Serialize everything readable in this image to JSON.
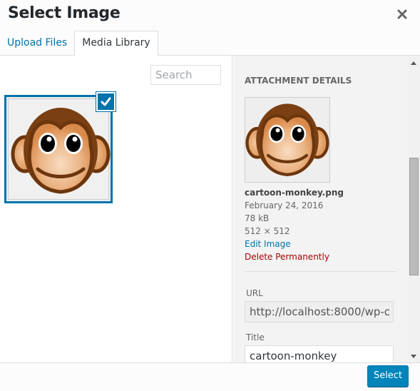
{
  "header": {
    "title": "Select Image",
    "close_icon": "close-icon"
  },
  "tabs": [
    {
      "label": "Upload Files",
      "active": false
    },
    {
      "label": "Media Library",
      "active": true
    }
  ],
  "browser": {
    "search_placeholder": "Search",
    "items": [
      {
        "name": "cartoon-monkey",
        "selected": true,
        "check_icon": "checkmark-icon"
      }
    ]
  },
  "details": {
    "heading": "Attachment Details",
    "filename": "cartoon-monkey.png",
    "date": "February 24, 2016",
    "size": "78 kB",
    "dimensions": "512 × 512",
    "edit_link": "Edit Image",
    "delete_link": "Delete Permanently",
    "url_label": "URL",
    "url_value": "http://localhost:8000/wp-c",
    "title_label": "Title",
    "title_value": "cartoon-monkey"
  },
  "footer": {
    "select_label": "Select"
  },
  "colors": {
    "accent": "#0073aa",
    "button": "#0085ba",
    "delete": "#a00000"
  }
}
